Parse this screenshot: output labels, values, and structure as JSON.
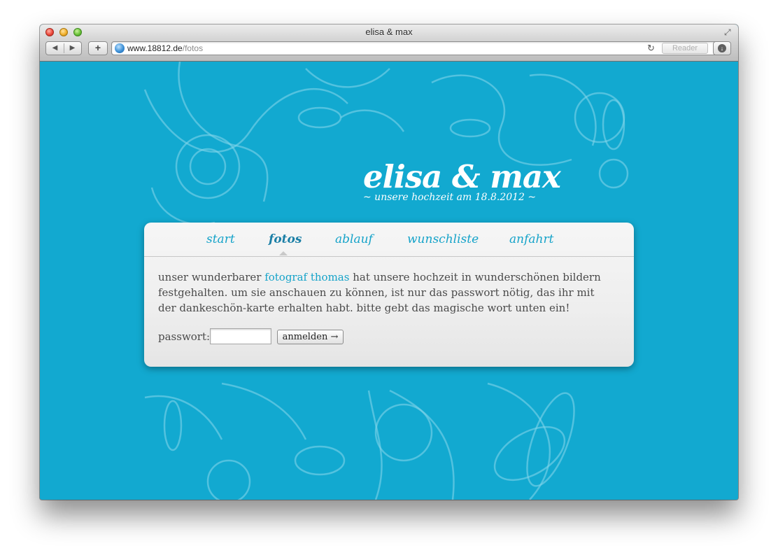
{
  "window": {
    "title": "elisa & max",
    "back_icon": "◀",
    "forward_icon": "▶",
    "add_tab_icon": "+",
    "url_host": "www.18812.de",
    "url_path": "/fotos",
    "reader_label": "Reader",
    "reload_icon": "↻",
    "downloads_icon": "↓",
    "fullscreen_icon": "⤢"
  },
  "site": {
    "title": "elisa & max",
    "subtitle": "~ unsere hochzeit am 18.8.2012 ~",
    "accent_color": "#12a9d0"
  },
  "nav": {
    "items": [
      {
        "label": "start"
      },
      {
        "label": "fotos",
        "active": true
      },
      {
        "label": "ablauf"
      },
      {
        "label": "wunschliste"
      },
      {
        "label": "anfahrt"
      }
    ]
  },
  "intro": {
    "before": "unser wunderbarer ",
    "link": "fotograf thomas",
    "after": " hat unsere hochzeit in wunderschönen bildern festgehalten. um sie anschauen zu können, ist nur das passwort nötig, das ihr mit der dankeschön-karte erhalten habt. bitte gebt das magische wort unten ein!"
  },
  "login": {
    "label": "passwort:",
    "value": "",
    "button_label": "anmelden →"
  }
}
